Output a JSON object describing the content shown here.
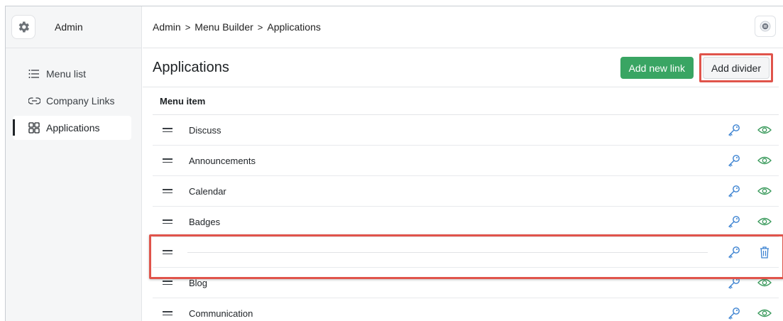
{
  "sidebar": {
    "brand": {
      "title": "Admin",
      "icon": "gear-icon"
    },
    "items": [
      {
        "label": "Menu list",
        "icon": "list-icon",
        "active": false
      },
      {
        "label": "Company Links",
        "icon": "link-icon",
        "active": false
      },
      {
        "label": "Applications",
        "icon": "grid-icon",
        "active": true
      }
    ]
  },
  "header": {
    "breadcrumb": [
      "Admin",
      "Menu Builder",
      "Applications"
    ],
    "separator": ">",
    "action_icon": "avatar-chat-icon"
  },
  "main": {
    "title": "Applications",
    "buttons": {
      "add_link": "Add new link",
      "add_divider": "Add divider"
    },
    "table": {
      "column_header": "Menu item",
      "rows": [
        {
          "label": "Discuss",
          "type": "link"
        },
        {
          "label": "Announcements",
          "type": "link"
        },
        {
          "label": "Calendar",
          "type": "link"
        },
        {
          "label": "Badges",
          "type": "link"
        },
        {
          "label": "",
          "type": "divider"
        },
        {
          "label": "Blog",
          "type": "link"
        },
        {
          "label": "Communication",
          "type": "link"
        }
      ]
    }
  },
  "colors": {
    "primary_green": "#39a563",
    "key_icon_blue": "#3b82d1",
    "eye_icon_green": "#3a9a5c",
    "highlight_red": "#e0544b"
  }
}
